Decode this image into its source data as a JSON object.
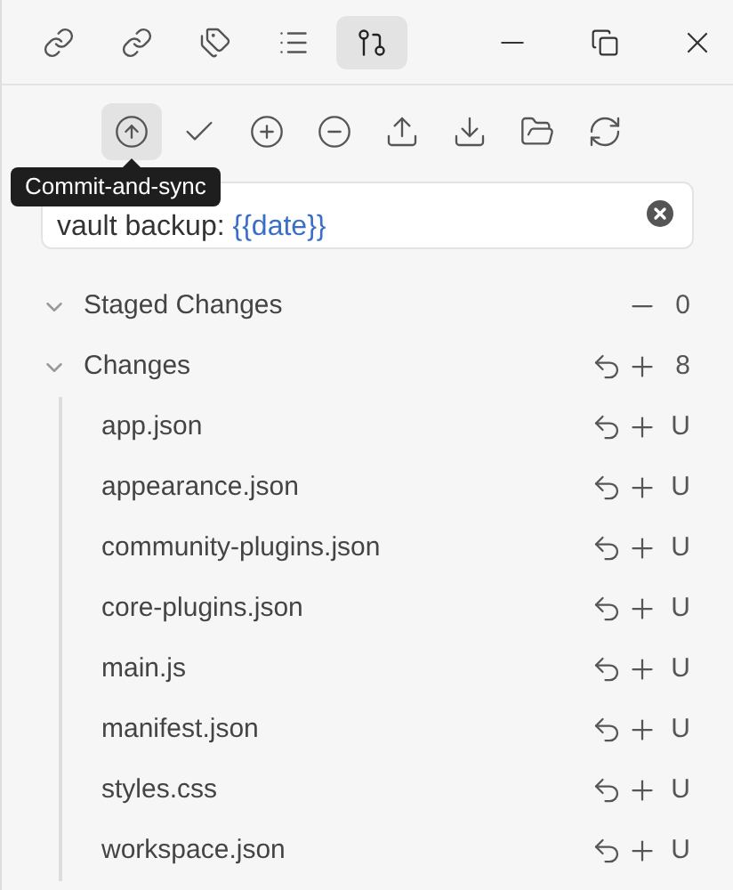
{
  "tabs": [
    {
      "selected": false
    },
    {
      "selected": false
    },
    {
      "selected": false
    },
    {
      "selected": false
    },
    {
      "selected": true
    }
  ],
  "toolbar": [
    {
      "highlighted": true
    },
    {
      "highlighted": false
    },
    {
      "highlighted": false
    },
    {
      "highlighted": false
    },
    {
      "highlighted": false
    },
    {
      "highlighted": false
    },
    {
      "highlighted": false
    },
    {
      "highlighted": false
    }
  ],
  "tooltip": {
    "text": "Commit-and-sync"
  },
  "commit_message": {
    "value": "vault backup: ",
    "variable": "{{date}}"
  },
  "sections": [
    {
      "kind": "staged",
      "title": "Staged Changes",
      "expanded": true,
      "count": "0"
    },
    {
      "kind": "unstaged",
      "title": "Changes",
      "expanded": true,
      "count": "8",
      "files": [
        {
          "name": "app.json",
          "status": "U"
        },
        {
          "name": "appearance.json",
          "status": "U"
        },
        {
          "name": "community-plugins.json",
          "status": "U"
        },
        {
          "name": "core-plugins.json",
          "status": "U"
        },
        {
          "name": "main.js",
          "status": "U"
        },
        {
          "name": "manifest.json",
          "status": "U"
        },
        {
          "name": "styles.css",
          "status": "U"
        },
        {
          "name": "workspace.json",
          "status": "U"
        }
      ]
    }
  ]
}
